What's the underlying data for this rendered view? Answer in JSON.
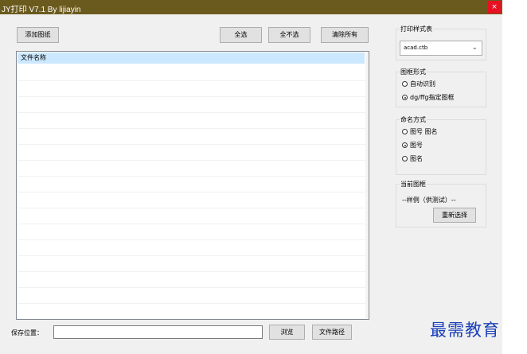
{
  "window": {
    "title": "JY打印 V7.1 By lijiayin",
    "close_glyph": "×"
  },
  "toolbar": {
    "add_drawing": "添加图纸",
    "select_all": "全选",
    "select_none": "全不选",
    "clear_all": "清除所有"
  },
  "file_list": {
    "header": "文件名称",
    "rows": []
  },
  "print_style": {
    "title": "打印样式表",
    "selected": "acad.ctb"
  },
  "frame_type": {
    "title": "图框形式",
    "options": [
      {
        "label": "自动识别",
        "checked": false
      },
      {
        "label": "dg/ffg指定图框",
        "checked": true
      }
    ]
  },
  "naming": {
    "title": "命名方式",
    "options": [
      {
        "label": "图号 图名",
        "checked": false
      },
      {
        "label": "图号",
        "checked": true
      },
      {
        "label": "图名",
        "checked": false
      }
    ]
  },
  "current_frame": {
    "title": "当前图框",
    "sample": "--样例（供测试）--",
    "reselect": "重新选择"
  },
  "save": {
    "label": "保存位置：",
    "value": "",
    "browse": "浏览",
    "file_path": "文件路径"
  },
  "watermark": "最需教育"
}
